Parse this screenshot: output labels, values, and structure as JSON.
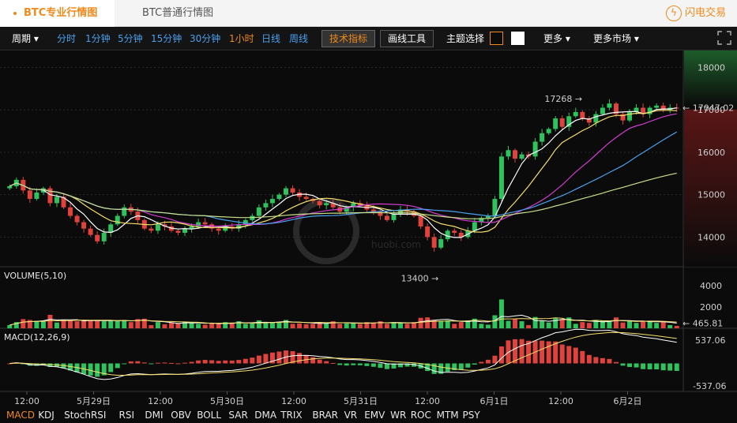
{
  "tabs": {
    "pro": "BTC专业行情图",
    "normal": "BTC普通行情图"
  },
  "brand": {
    "name": "闪电交易"
  },
  "toolbar": {
    "period_label": "周期",
    "intervals": [
      "分时",
      "1分钟",
      "5分钟",
      "15分钟",
      "30分钟",
      "1小时",
      "日线",
      "周线"
    ],
    "active_interval": "1小时",
    "indicators_btn": "技术指标",
    "drawing_btn": "画线工具",
    "theme_label": "主题选择",
    "more_label": "更多",
    "more_markets_label": "更多市场"
  },
  "indicators": [
    "MACD",
    "KDJ",
    "StochRSI",
    "RSI",
    "DMI",
    "OBV",
    "BOLL",
    "SAR",
    "DMA",
    "TRIX",
    "BRAR",
    "VR",
    "EMV",
    "WR",
    "ROC",
    "MTM",
    "PSY"
  ],
  "active_indicator": "MACD",
  "watermark": {
    "text": "huobi.com",
    "glyph": "火币"
  },
  "colors": {
    "up": "#2ec35c",
    "down": "#e0433c",
    "accent": "#f08a1c",
    "ma5": "#ffffff",
    "ma10": "#f5e06a",
    "ma20": "#d33cd1",
    "ma30": "#4aa0f0",
    "ma60": "#c8e08a"
  },
  "chart_data": [
    {
      "type": "candlestick",
      "title": "",
      "y_ticks": [
        "18000",
        "17000",
        "16000",
        "15000",
        "14000"
      ],
      "ylim": [
        13300,
        18400
      ],
      "x_ticks": [
        "12:00",
        "5月29日",
        "12:00",
        "5月30日",
        "12:00",
        "5月31日",
        "12:00",
        "6月1日",
        "12:00",
        "6月2日"
      ],
      "annotations": {
        "high": "17268",
        "low": "13400",
        "last_price": "17047.02"
      },
      "series": [
        {
          "name": "close",
          "values": [
            15200,
            15350,
            15100,
            14900,
            15050,
            15150,
            14800,
            14950,
            14700,
            14500,
            14350,
            14200,
            14050,
            13900,
            14100,
            14300,
            14500,
            14700,
            14600,
            14400,
            14200,
            14150,
            14300,
            14250,
            14150,
            14100,
            14200,
            14250,
            14350,
            14300,
            14200,
            14150,
            14250,
            14200,
            14300,
            14400,
            14500,
            14700,
            14800,
            14900,
            15000,
            15150,
            15050,
            14950,
            14900,
            14850,
            14750,
            14800,
            14700,
            14600,
            14700,
            14800,
            14750,
            14650,
            14600,
            14500,
            14400,
            14550,
            14650,
            14600,
            14500,
            14250,
            14000,
            13750,
            13950,
            14150,
            14100,
            14000,
            14150,
            14350,
            14450,
            14500,
            14900,
            15900,
            16050,
            15850,
            15950,
            15900,
            16250,
            16450,
            16550,
            16800,
            16600,
            16850,
            16950,
            16800,
            16700,
            16900,
            17050,
            17150,
            16900,
            16750,
            16950,
            17050,
            16900,
            17050,
            17100,
            17000,
            17050,
            17047
          ]
        },
        {
          "name": "MA5",
          "values": []
        }
      ]
    },
    {
      "type": "bar",
      "title": "VOLUME(5,10)",
      "y_ticks": [
        "4000",
        "2000"
      ],
      "last_value": "465.81"
    },
    {
      "type": "bar",
      "title": "MACD(12,26,9)",
      "y_ticks": [
        "537.06",
        "-537.06"
      ]
    }
  ]
}
